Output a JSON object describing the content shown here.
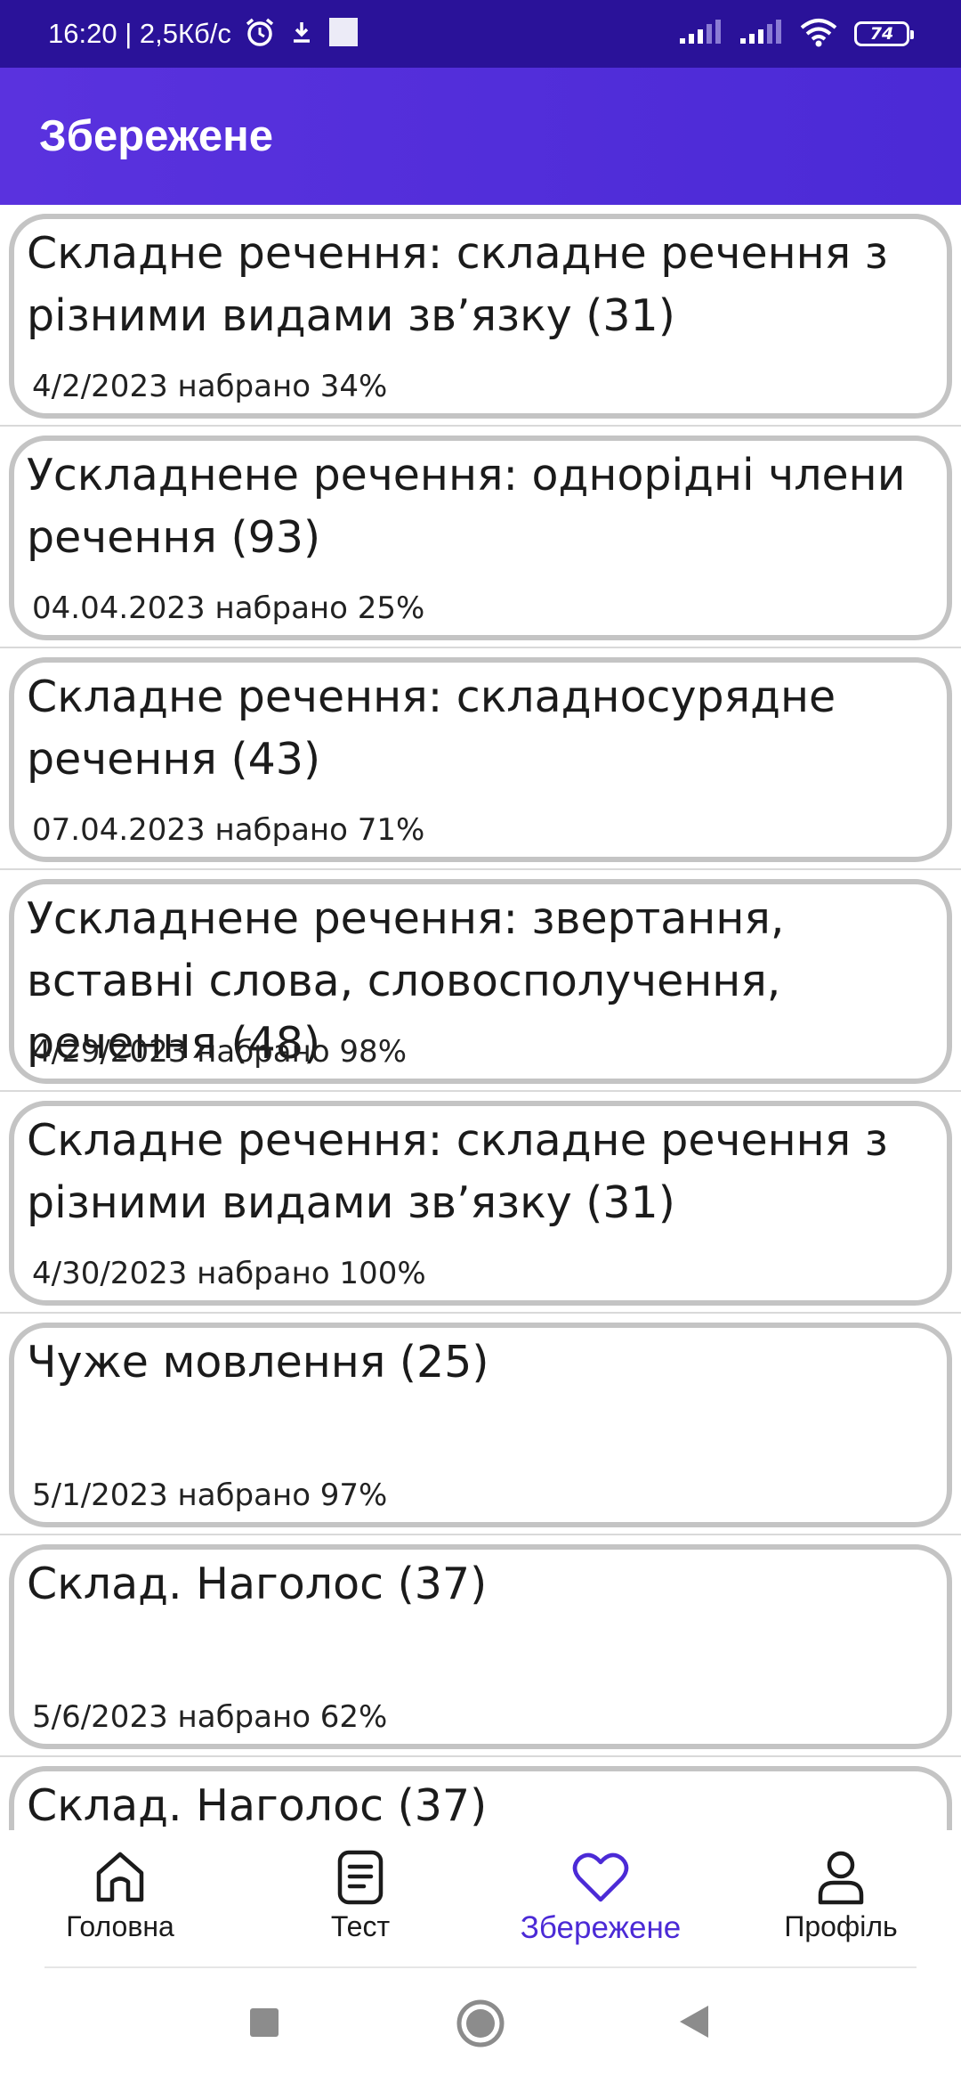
{
  "status_bar": {
    "time_speed": "16:20 | 2,5Кб/с",
    "battery": "74",
    "icons": [
      "alarm-icon",
      "download-icon",
      "notification-square-icon",
      "signal-icon",
      "signal-icon",
      "wifi-icon",
      "battery-icon"
    ]
  },
  "app_bar": {
    "title": "Збережене"
  },
  "saved_items": [
    {
      "title": "Складне речення: складне речення з різними видами зв’язку (31)",
      "subtitle": "4/2/2023 набрано 34%"
    },
    {
      "title": "Ускладнене речення: однорідні члени речення (93)",
      "subtitle": "04.04.2023 набрано 25%"
    },
    {
      "title": "Складне речення: складносурядне речення (43)",
      "subtitle": "07.04.2023 набрано 71%"
    },
    {
      "title": "Ускладнене речення: звертання, вставні слова, словосполучення, речення (48)",
      "subtitle": "4/29/2023 набрано 98%"
    },
    {
      "title": "Складне речення: складне речення з різними видами зв’язку (31)",
      "subtitle": "4/30/2023 набрано 100%"
    },
    {
      "title": "Чуже мовлення (25)",
      "subtitle": "5/1/2023 набрано 97%"
    },
    {
      "title": "Склад. Наголос (37)",
      "subtitle": "5/6/2023 набрано 62%"
    },
    {
      "title": "Склад. Наголос (37)",
      "subtitle": ""
    }
  ],
  "bottom_nav": {
    "items": [
      {
        "label": "Головна",
        "icon": "home-icon"
      },
      {
        "label": "Тест",
        "icon": "document-icon"
      },
      {
        "label": "Збережене",
        "icon": "heart-icon",
        "active": true
      },
      {
        "label": "Профіль",
        "icon": "user-icon"
      }
    ]
  },
  "colors": {
    "status_bar": "#2a1299",
    "app_bar": "#5a32de",
    "accent": "#4b2ad6",
    "card_border": "#c4c4c4"
  }
}
